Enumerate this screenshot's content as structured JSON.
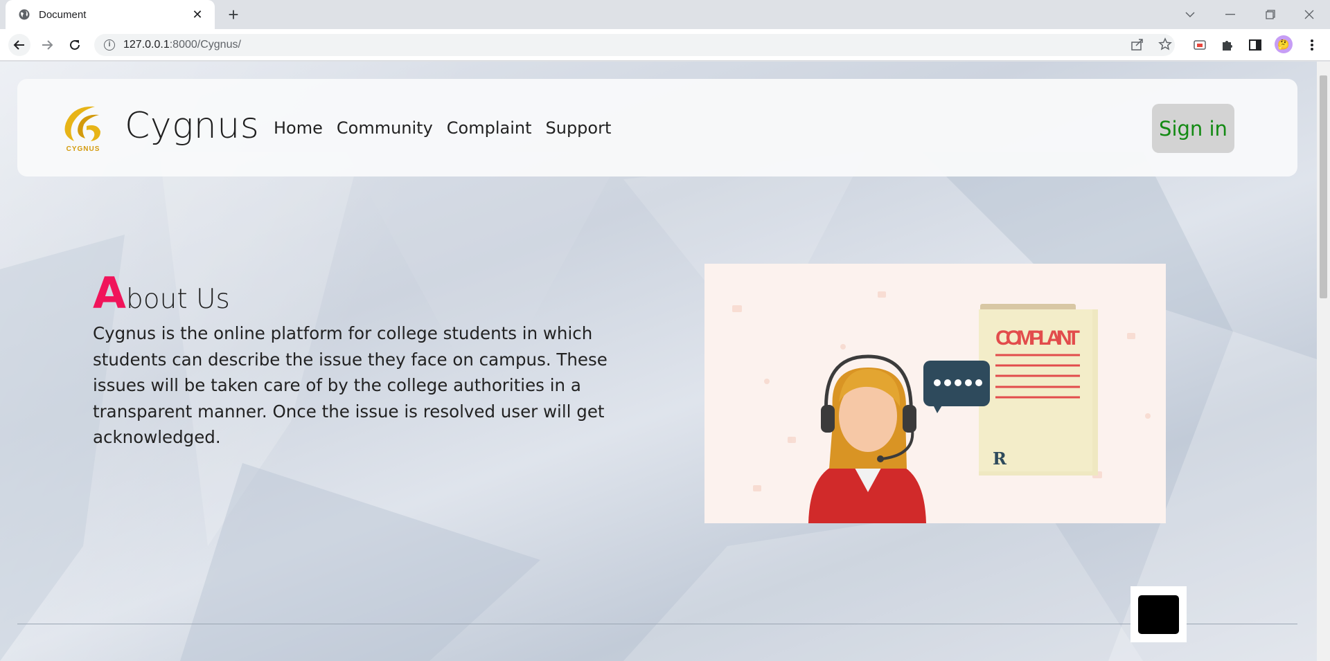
{
  "browser": {
    "tab_title": "Document",
    "new_tab_label": "+",
    "url_host": "127.0.0.1",
    "url_path": ":8000/Cygnus/"
  },
  "site": {
    "brand": "Cygnus",
    "logo_text": "CYGNUS",
    "nav": {
      "items": [
        {
          "label": "Home"
        },
        {
          "label": "Community"
        },
        {
          "label": "Complaint"
        },
        {
          "label": "Support"
        }
      ],
      "signin_label": "Sign in"
    },
    "about": {
      "title_initial": "A",
      "title_rest": "bout Us",
      "text": "Cygnus is the online platform for college students in which students can describe the issue they face on campus. These issues will be taken care of by the college authorities in a transparent manner. Once the issue is resolved user will get acknowledged."
    },
    "illustration": {
      "document_label": "COMPLAINT",
      "signature_text": "R"
    }
  },
  "colors": {
    "accent_initial": "#f0145a",
    "signin_text": "#138a13",
    "signin_bg": "#d3d3d3"
  }
}
